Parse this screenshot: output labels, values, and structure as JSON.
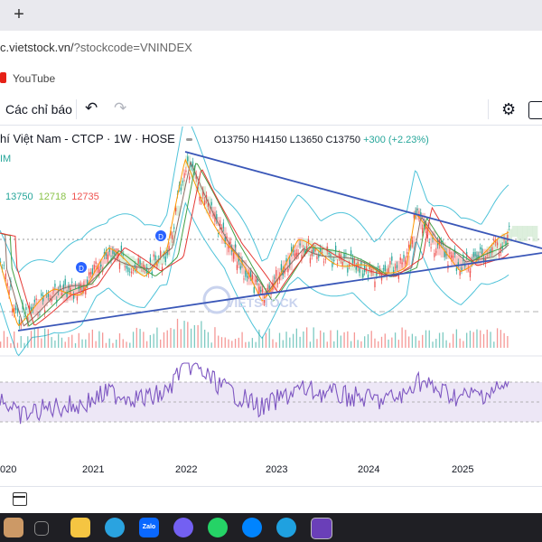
{
  "browser": {
    "newtab_label": "+",
    "url_main": "c.vietstock.vn/",
    "url_query": "?stockcode=VNINDEX",
    "bookmark_youtube": "YouTube"
  },
  "toolbar": {
    "indicators_label": "Các chỉ báo",
    "undo_icon": "↶",
    "redo_icon": "↷",
    "settings_icon": "⚙"
  },
  "legend": {
    "symbol": "hí Việt Nam - CTCP · 1W · HOSE",
    "open": "O13750",
    "high": "H14150",
    "low": "L13650",
    "close": "C13750",
    "change": "+300 (+2.23%)"
  },
  "indicator": {
    "m_label": "IM",
    "v1": "13750",
    "v2": "12718",
    "v3": "12735"
  },
  "markers": [
    "D",
    "D",
    "D"
  ],
  "watermark": "VIETSTOCK",
  "x_axis": [
    "020",
    "2021",
    "2022",
    "2023",
    "2024",
    "2025"
  ],
  "colors": {
    "up": "#26a69a",
    "down": "#ef5350",
    "trendline": "#3a57b8",
    "rsi": "#7e57c2",
    "cloud_red": "#f6b4b4",
    "cloud_green": "#cfe8cf"
  }
}
